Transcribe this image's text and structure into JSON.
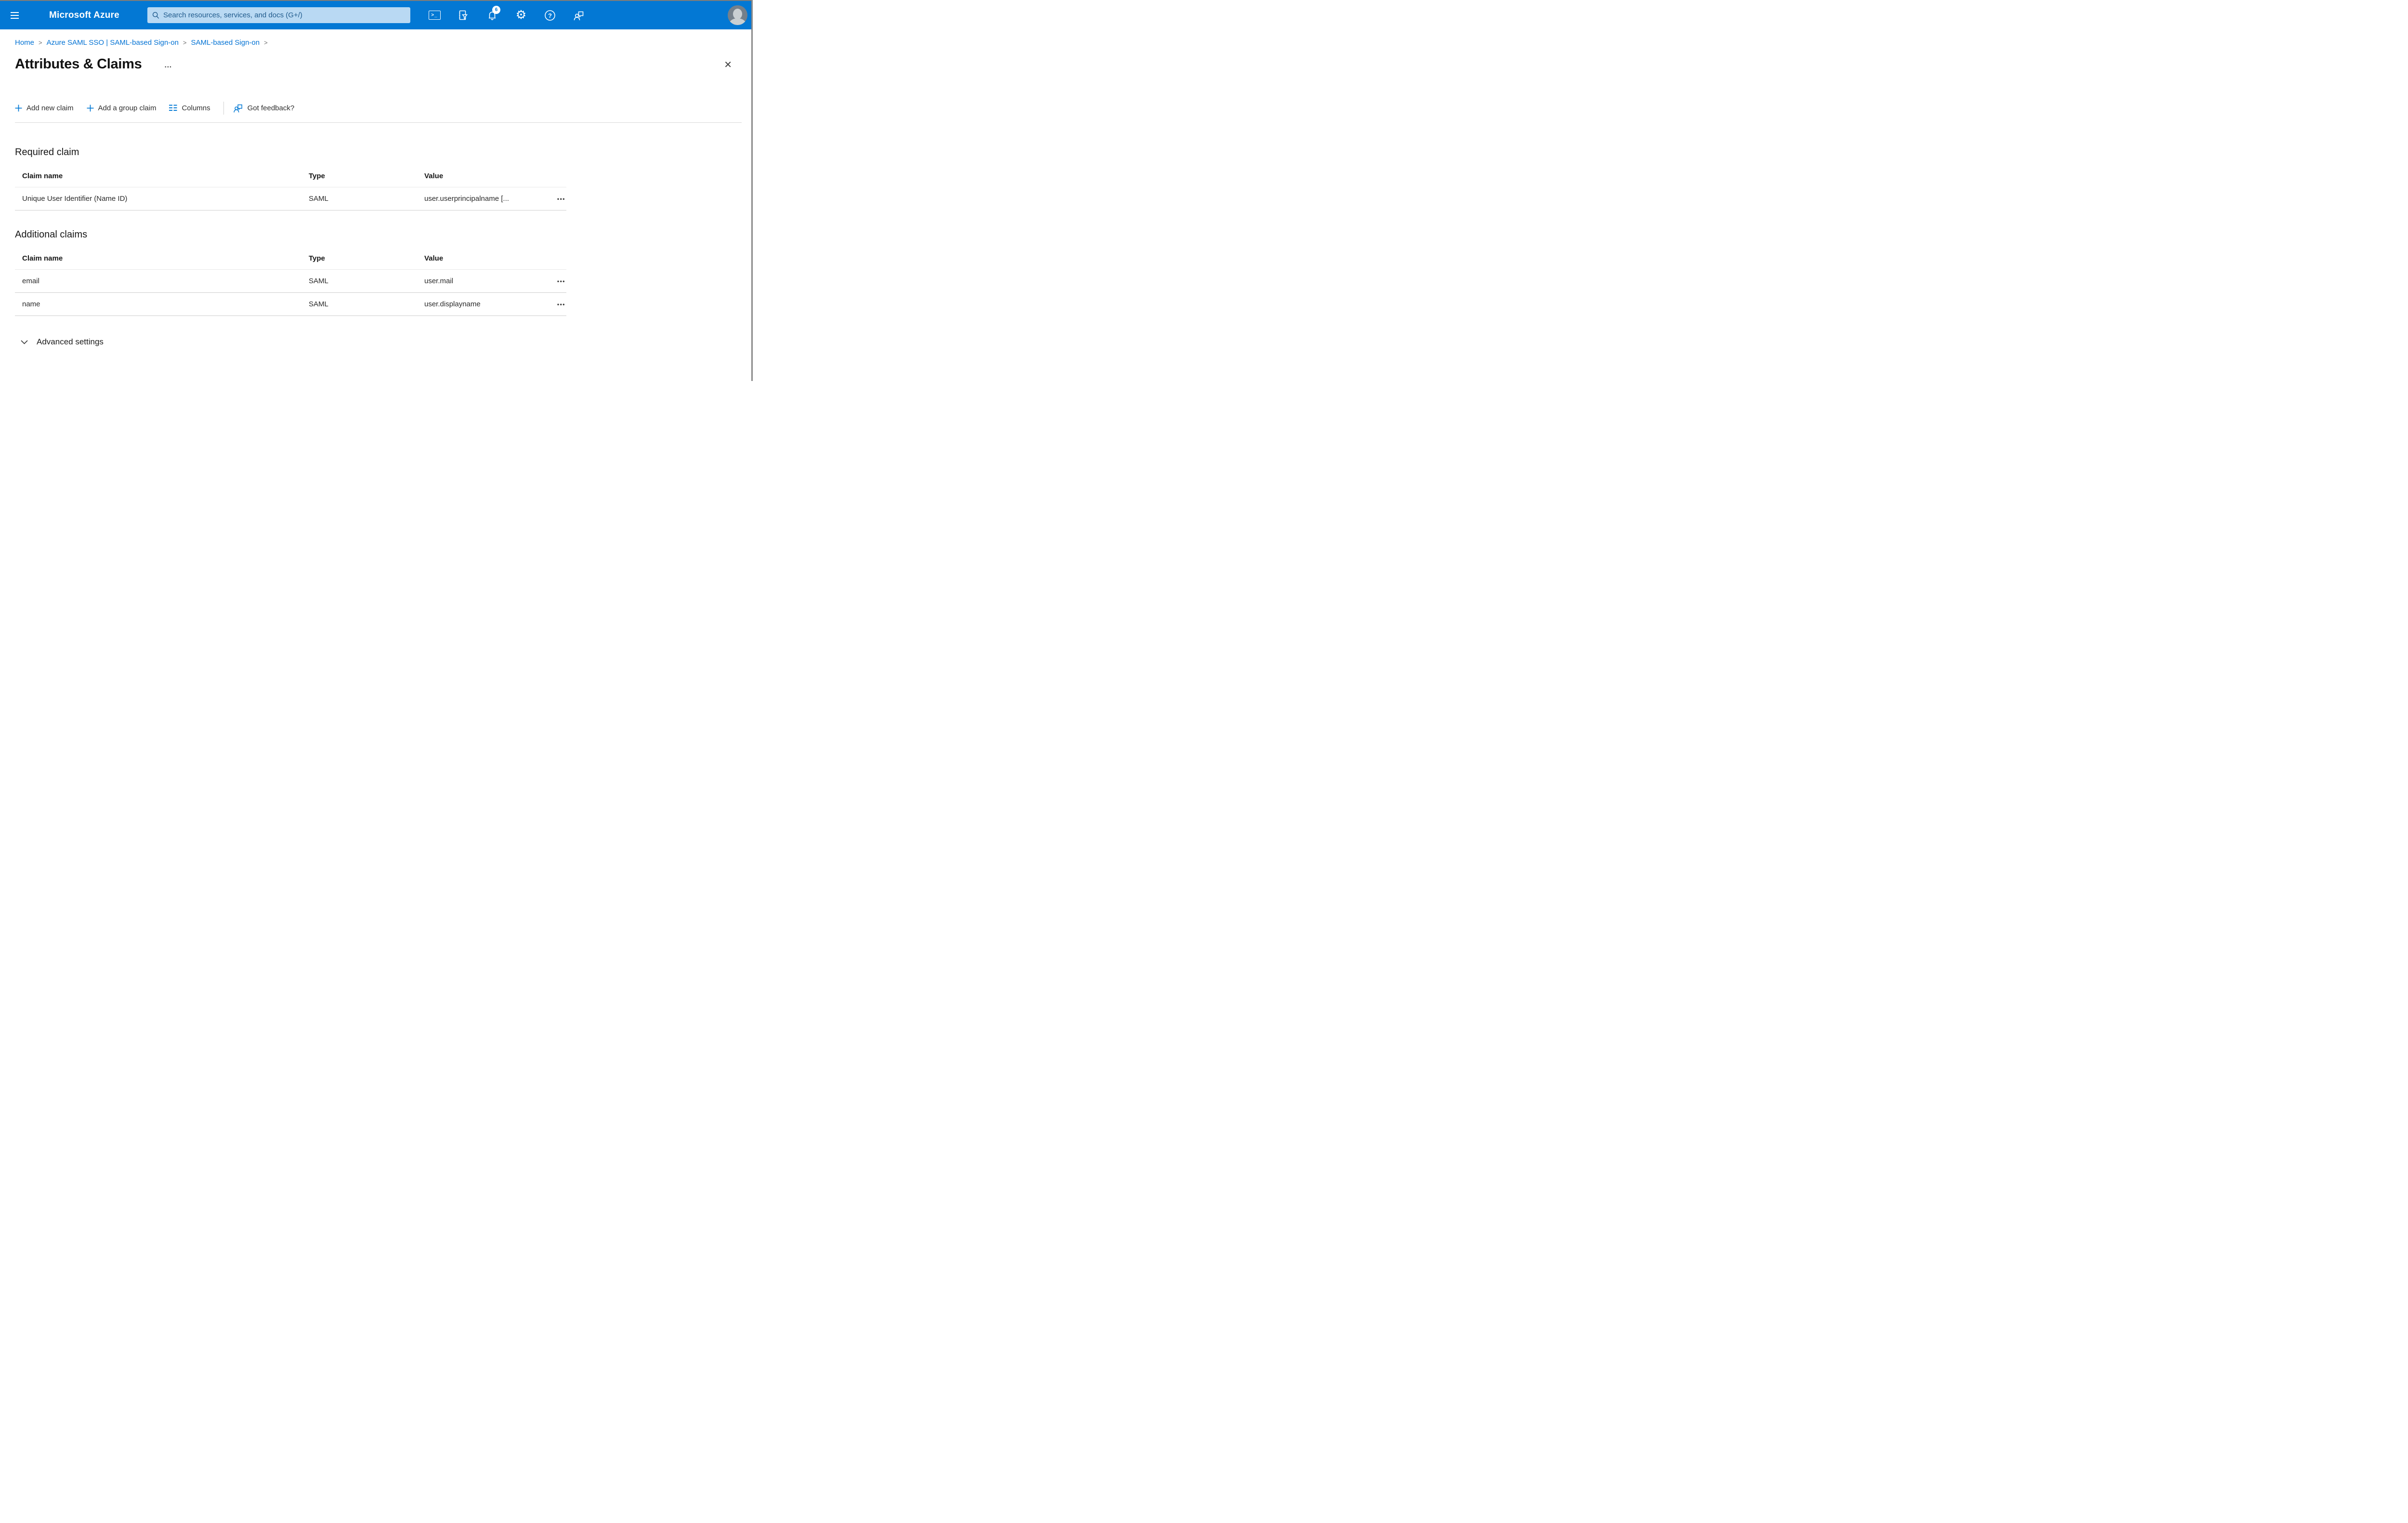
{
  "topbar": {
    "brand": "Microsoft Azure",
    "search_placeholder": "Search resources, services, and docs (G+/)",
    "notification_count": "6",
    "cloud_shell_glyph": ">_",
    "help_glyph": "?",
    "gear_glyph": "⚙"
  },
  "breadcrumb": {
    "separator": ">",
    "items": [
      {
        "label": "Home"
      },
      {
        "label": "Azure SAML SSO | SAML-based Sign-on"
      },
      {
        "label": "SAML-based Sign-on"
      }
    ]
  },
  "page": {
    "title": "Attributes & Claims",
    "title_menu_glyph": "…",
    "close_glyph": "✕"
  },
  "toolbar": {
    "add_new_claim": "Add new claim",
    "add_group_claim": "Add a group claim",
    "columns": "Columns",
    "feedback": "Got feedback?"
  },
  "required_claim": {
    "heading": "Required claim",
    "columns": [
      "Claim name",
      "Type",
      "Value"
    ],
    "rows": [
      {
        "claim_name": "Unique User Identifier (Name ID)",
        "type": "SAML",
        "value": "user.userprincipalname [...",
        "menu_glyph": "•••"
      }
    ]
  },
  "additional_claims": {
    "heading": "Additional claims",
    "columns": [
      "Claim name",
      "Type",
      "Value"
    ],
    "rows": [
      {
        "claim_name": "email",
        "type": "SAML",
        "value": "user.mail",
        "menu_glyph": "•••"
      },
      {
        "claim_name": "name",
        "type": "SAML",
        "value": "user.displayname",
        "menu_glyph": "•••"
      }
    ]
  },
  "advanced_settings": {
    "label": "Advanced settings"
  },
  "colors": {
    "topbar_bg": "#0378d4",
    "accent": "#0078d4",
    "search_bg": "#b9d9f3",
    "search_text": "#1f5a8c",
    "link": "#0272d4",
    "divider": "#d8d8d8",
    "text": "#242424"
  }
}
